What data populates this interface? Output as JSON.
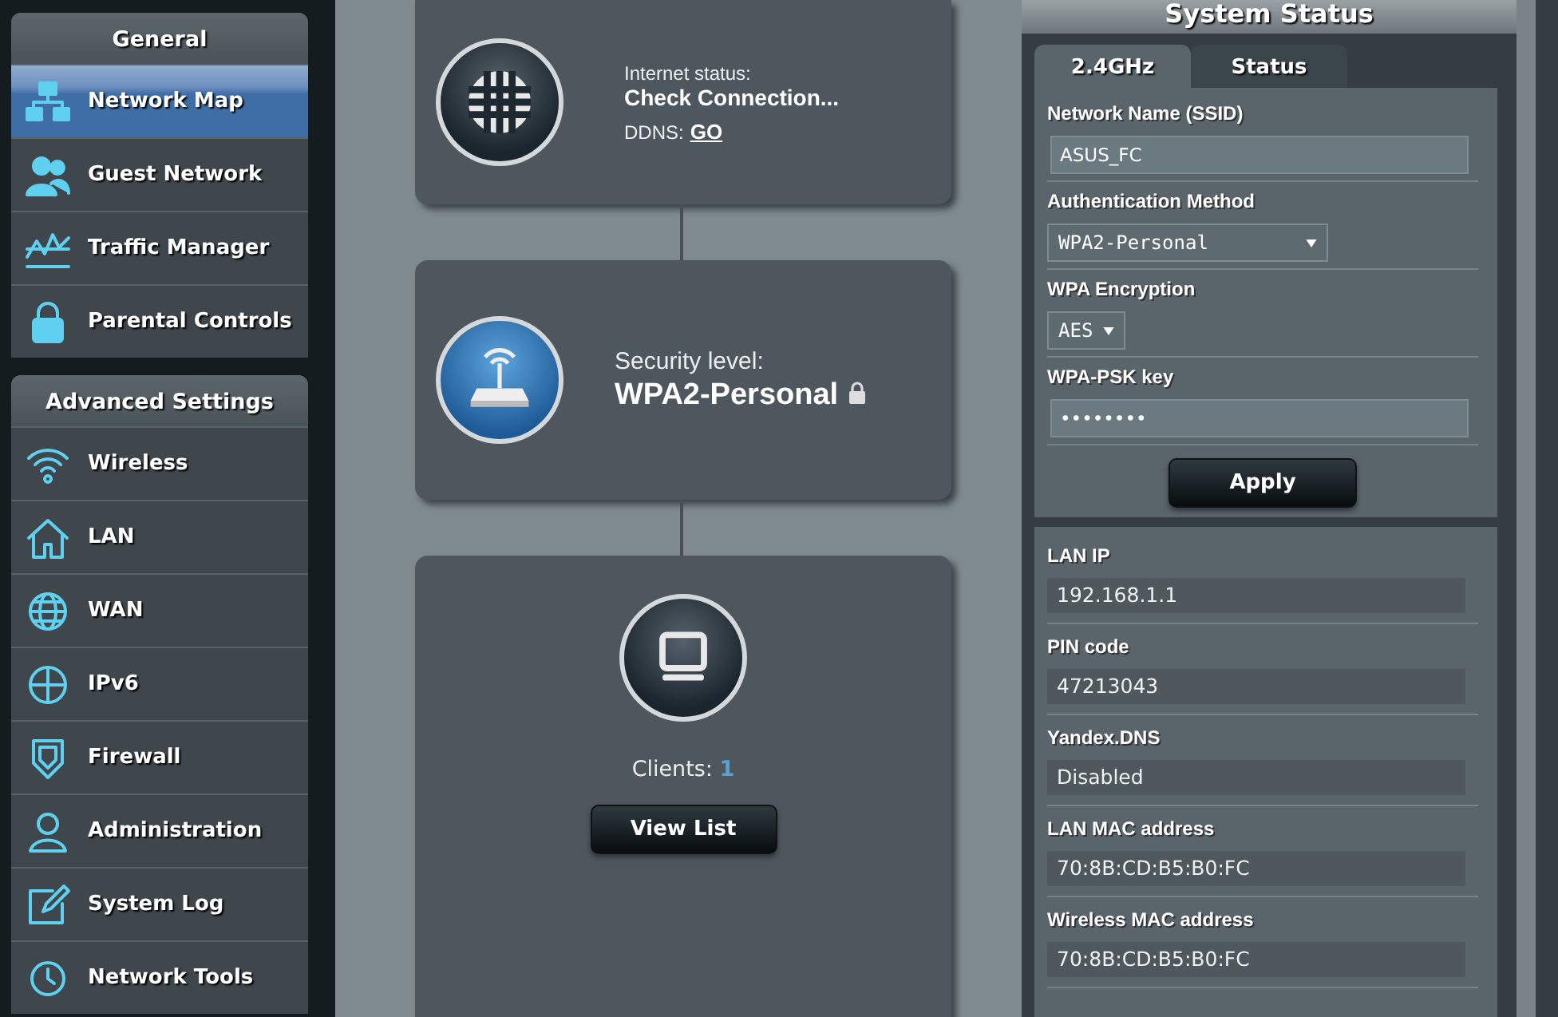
{
  "sidebar": {
    "sections": [
      {
        "title": "General",
        "items": [
          {
            "label": "Network Map",
            "selected": true
          },
          {
            "label": "Guest Network",
            "selected": false
          },
          {
            "label": "Traffic Manager",
            "selected": false
          },
          {
            "label": "Parental Controls",
            "selected": false
          }
        ]
      },
      {
        "title": "Advanced Settings",
        "items": [
          {
            "label": "Wireless",
            "selected": false
          },
          {
            "label": "LAN",
            "selected": false
          },
          {
            "label": "WAN",
            "selected": false
          },
          {
            "label": "IPv6",
            "selected": false
          },
          {
            "label": "Firewall",
            "selected": false
          },
          {
            "label": "Administration",
            "selected": false
          },
          {
            "label": "System Log",
            "selected": false
          },
          {
            "label": "Network Tools",
            "selected": false
          }
        ]
      }
    ]
  },
  "network_map": {
    "internet": {
      "label": "Internet status:",
      "value": "Check Connection...",
      "ddns_label": "DDNS:",
      "ddns_link": "GO"
    },
    "security": {
      "label": "Security level:",
      "value": "WPA2-Personal"
    },
    "clients": {
      "label": "Clients:",
      "count": "1",
      "button": "View List"
    }
  },
  "system_status": {
    "title": "System Status",
    "tabs": [
      {
        "label": "2.4GHz",
        "selected": true
      },
      {
        "label": "Status",
        "selected": false
      }
    ],
    "fields": [
      {
        "kind": "input",
        "label": "Network Name (SSID)",
        "value": "ASUS_FC"
      },
      {
        "kind": "select",
        "label": "Authentication Method",
        "value": "WPA2-Personal"
      },
      {
        "kind": "select-small",
        "label": "WPA Encryption",
        "value": "AES"
      },
      {
        "kind": "input",
        "label": "WPA-PSK key",
        "value": "••••••••"
      }
    ],
    "apply_button": "Apply",
    "info": [
      {
        "label": "LAN IP",
        "value": "192.168.1.1"
      },
      {
        "label": "PIN code",
        "value": "47213043"
      },
      {
        "label": "Yandex.DNS",
        "value": "Disabled"
      },
      {
        "label": "LAN MAC address",
        "value": "70:8B:CD:B5:B0:FC"
      },
      {
        "label": "Wireless MAC address",
        "value": "70:8B:CD:B5:B0:FC"
      }
    ]
  }
}
